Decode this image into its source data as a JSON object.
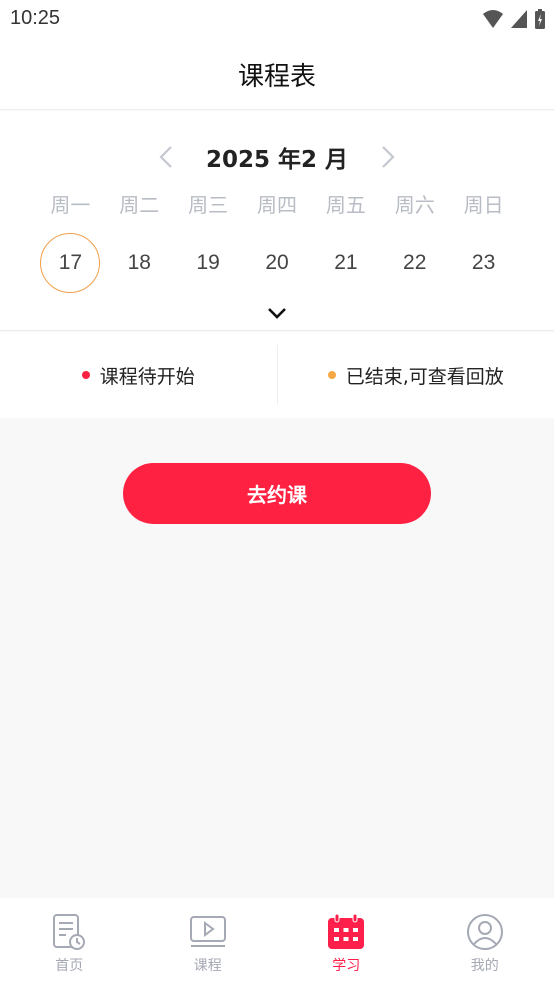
{
  "status_bar": {
    "time": "10:25"
  },
  "header": {
    "title": "课程表"
  },
  "calendar": {
    "month_label": "2025 年2 月",
    "weekdays": [
      "周一",
      "周二",
      "周三",
      "周四",
      "周五",
      "周六",
      "周日"
    ],
    "dates": [
      "17",
      "18",
      "19",
      "20",
      "21",
      "22",
      "23"
    ],
    "selected_date": "17"
  },
  "legend": {
    "pending": {
      "label": "课程待开始",
      "color": "#ff2142"
    },
    "ended": {
      "label": "已结束,可查看回放",
      "color": "#f5a845"
    }
  },
  "cta": {
    "label": "去约课"
  },
  "tabbar": {
    "tabs": [
      {
        "label": "首页",
        "icon": "home-icon"
      },
      {
        "label": "课程",
        "icon": "course-icon"
      },
      {
        "label": "学习",
        "icon": "calendar-icon",
        "active": true
      },
      {
        "label": "我的",
        "icon": "profile-icon"
      }
    ]
  },
  "colors": {
    "accent": "#ff2142",
    "selected_ring": "#f0a04b",
    "inactive_tab": "#a5a9b4"
  }
}
